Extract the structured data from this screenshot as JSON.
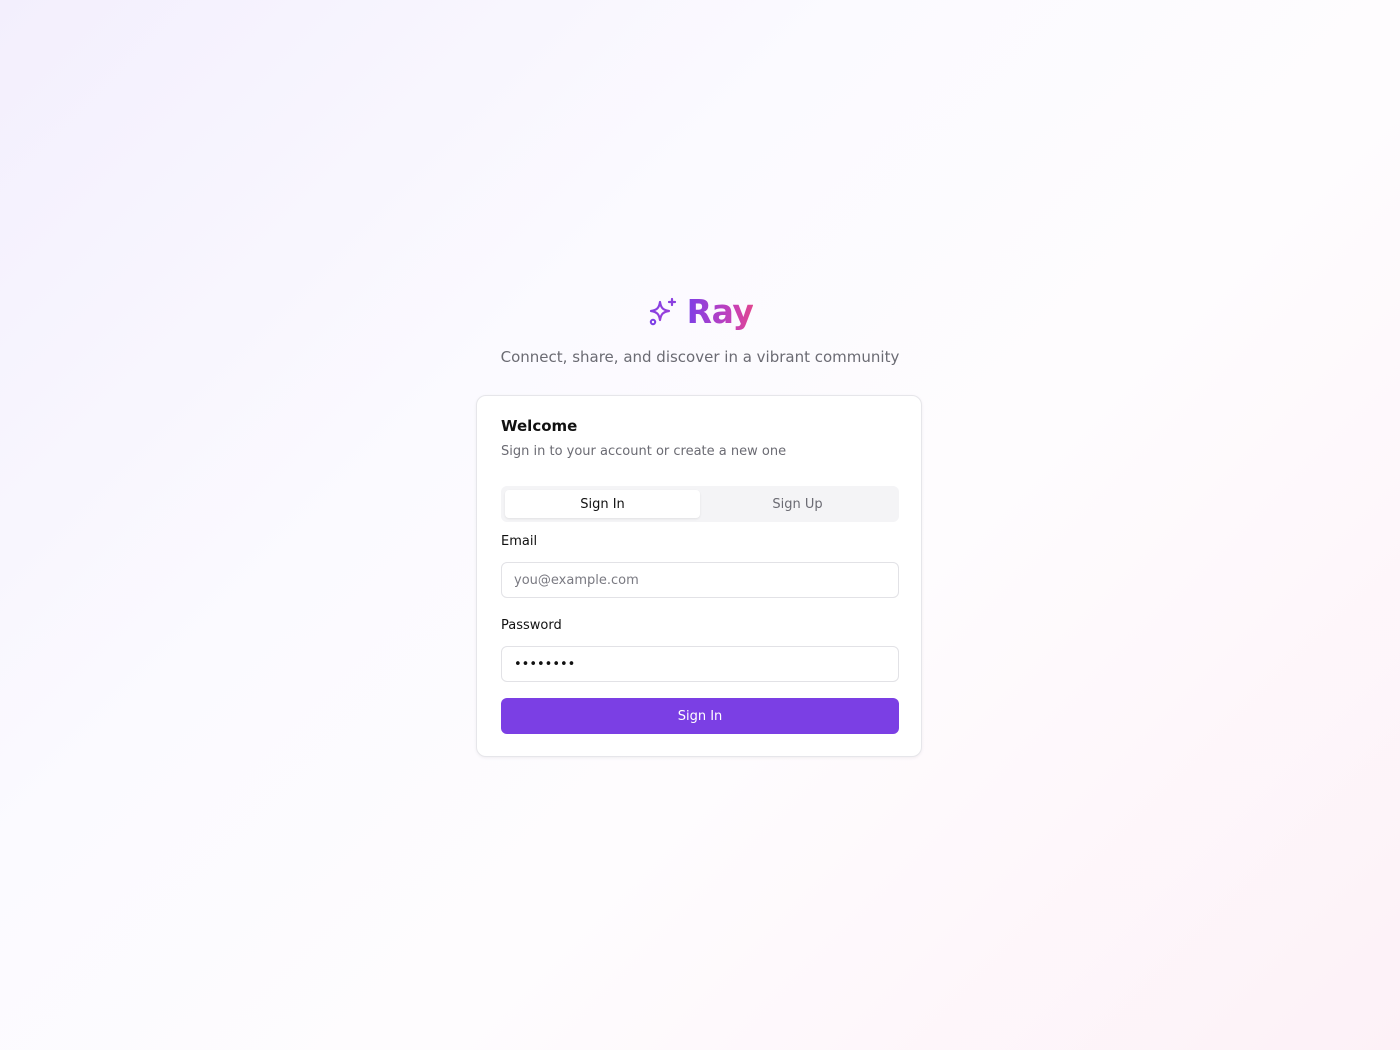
{
  "app": {
    "name": "Ray",
    "tagline": "Connect, share, and discover in a vibrant community",
    "logo_icon": "sparkles-icon",
    "brand_colors": {
      "primary": "#7b3fe4",
      "gradient_start": "#7e3fe6",
      "gradient_end": "#e0468f"
    }
  },
  "card": {
    "title": "Welcome",
    "subtitle": "Sign in to your account or create a new one",
    "tabs": [
      {
        "label": "Sign In",
        "active": true
      },
      {
        "label": "Sign Up",
        "active": false
      }
    ],
    "email": {
      "label": "Email",
      "placeholder": "you@example.com",
      "value": ""
    },
    "password": {
      "label": "Password",
      "value": "••••••••"
    },
    "submit_label": "Sign In"
  }
}
